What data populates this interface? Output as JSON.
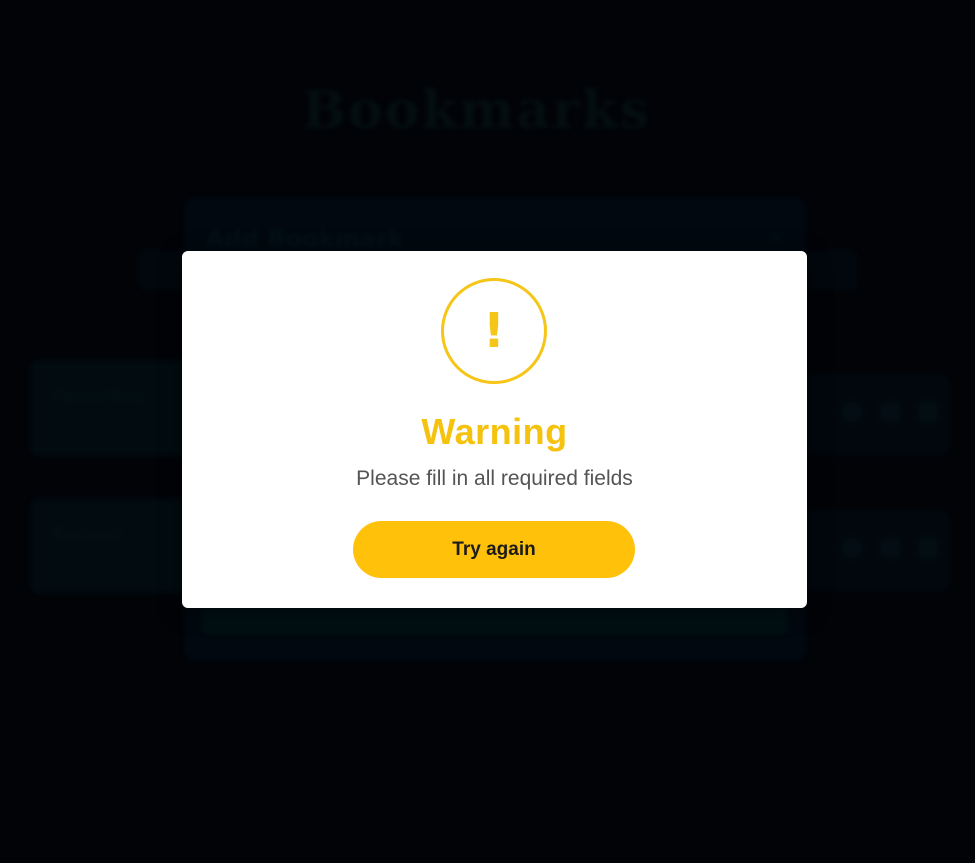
{
  "background": {
    "logo_text": "Bookmarks",
    "logo_sub": "",
    "cards_left": [
      {
        "label": "Favorites"
      },
      {
        "label": "Recent"
      }
    ]
  },
  "bookmark_dialog": {
    "title": "Add Bookmark",
    "close_glyph": "✕"
  },
  "alert": {
    "icon": "warning-exclamation-icon",
    "icon_glyph": "!",
    "title": "Warning",
    "message": "Please fill in all required fields",
    "button_label": "Try again"
  },
  "colors": {
    "page_background": "#02060d",
    "warning_yellow": "#f5c518",
    "button_yellow": "#ffc10a",
    "message_gray": "#545454"
  }
}
